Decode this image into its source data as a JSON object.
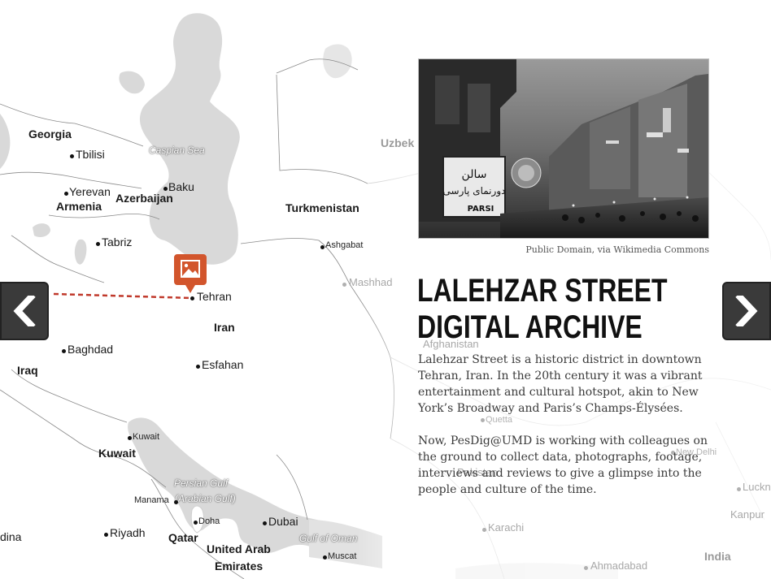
{
  "map": {
    "labels": {
      "georgia": "Georgia",
      "tbilisi": "Tbilisi",
      "caspian_sea": "Caspian Sea",
      "yerevan": "Yerevan",
      "armenia": "Armenia",
      "baku": "Baku",
      "azerbaijan": "Azerbaijan",
      "turkmenistan": "Turkmenistan",
      "uzbek": "Uzbek",
      "tabriz": "Tabriz",
      "ashgabat": "Ashgabat",
      "mashhad": "Mashhad",
      "tehran": "Tehran",
      "iran": "Iran",
      "baghdad": "Baghdad",
      "iraq": "Iraq",
      "esfahan": "Esfahan",
      "kuwait_city": "Kuwait",
      "kuwait": "Kuwait",
      "persian_gulf": "Persian Gulf",
      "arabian_gulf": "(Arabian Gulf)",
      "manama": "Manama",
      "doha": "Doha",
      "dubai": "Dubai",
      "riyadh": "Riyadh",
      "qatar": "Qatar",
      "uae_1": "United Arab",
      "uae_2": "Emirates",
      "gulf_of_oman": "Gulf of Oman",
      "muscat": "Muscat",
      "dina": "dina",
      "afghanistan": "Afghanistan",
      "quetta": "Quetta",
      "new_delhi": "New Delhi",
      "pakistan": "Pakistan",
      "lucknow": "Luckn",
      "kanpur": "Kanpur",
      "karachi": "Karachi",
      "ahmadabad": "Ahmadabad",
      "india": "India"
    },
    "marker_icon": "photo-icon"
  },
  "panel": {
    "photo_alt": "Historic photograph of Lalehzar Street at night",
    "sign_text": "PARSI",
    "credit": "Public Domain, via Wikimedia Commons",
    "title_line1": "LALEHZAR STREET",
    "title_line2": "DIGITAL ARCHIVE",
    "paragraph1": "Lalehzar Street is a historic district in downtown Tehran, Iran. In the 20th century it was a vibrant entertainment and cultural hotspot, akin to New York’s Broadway and Paris’s Champs-Élysées.",
    "paragraph2": "Now, PesDig@UMD is working with colleagues on the ground to collect data, photographs, footage, interviews and reviews to give a glimpse into the people and culture of the time."
  },
  "nav": {
    "prev_icon": "chevron-left-icon",
    "next_icon": "chevron-right-icon"
  },
  "colors": {
    "marker": "#d2552c",
    "route": "#c0392b",
    "nav_bg": "#3a3a3a",
    "land_gray": "#d9d9d9"
  }
}
